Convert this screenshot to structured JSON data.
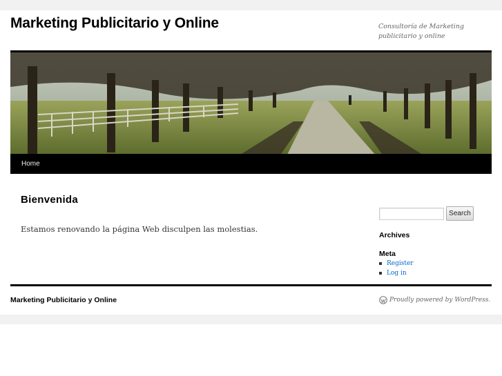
{
  "header": {
    "site_title": "Marketing Publicitario y Online",
    "site_description": "Consultoría de Marketing publicitario y online"
  },
  "nav": {
    "items": [
      {
        "label": "Home"
      }
    ]
  },
  "main": {
    "entry_title": "Bienvenida",
    "entry_text": "Estamos renovando la página Web disculpen las molestias."
  },
  "sidebar": {
    "search": {
      "placeholder": "",
      "button_label": "Search"
    },
    "archives_title": "Archives",
    "meta_title": "Meta",
    "meta_links": [
      {
        "label": "Register"
      },
      {
        "label": "Log in"
      }
    ]
  },
  "footer": {
    "site_title": "Marketing Publicitario y Online",
    "powered_by": "Proudly powered by WordPress.",
    "icon": "wordpress-icon"
  }
}
